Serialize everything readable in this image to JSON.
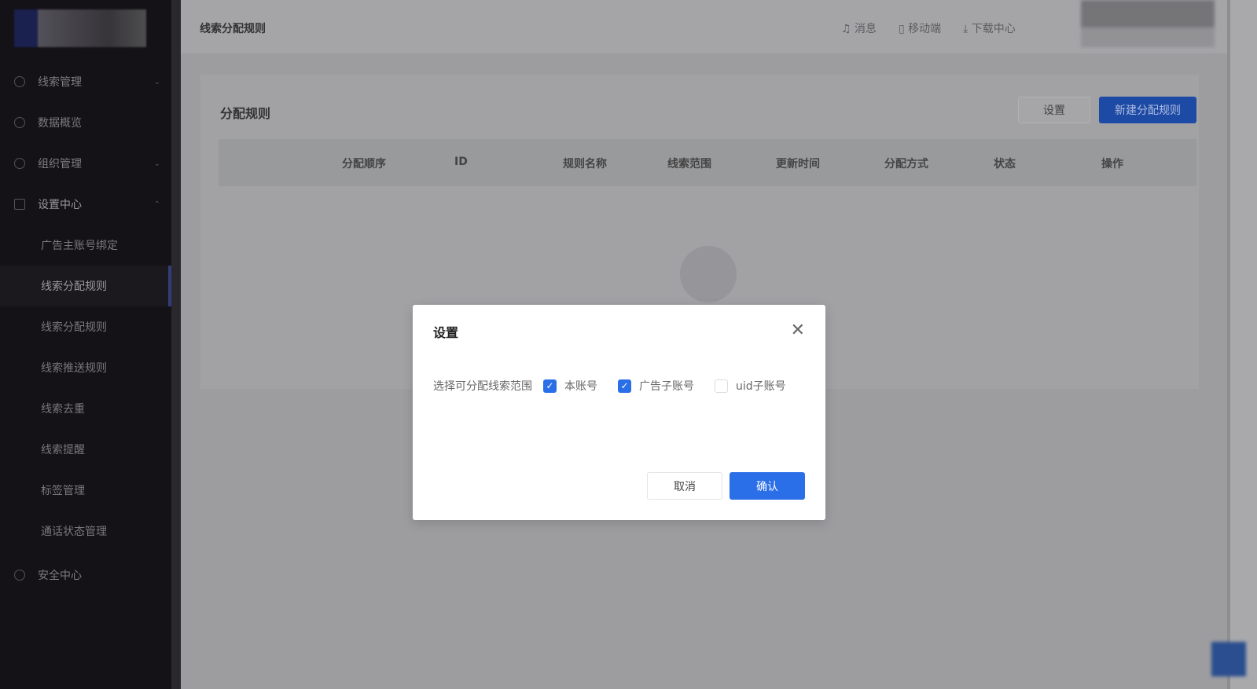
{
  "sidebar": {
    "items": [
      {
        "label": "线索管理"
      },
      {
        "label": "数据概览"
      },
      {
        "label": "组织管理"
      },
      {
        "label": "设置中心"
      }
    ],
    "sub_items": [
      {
        "label": "广告主账号绑定"
      },
      {
        "label": "线索分配规则"
      },
      {
        "label": "线索分配规则"
      },
      {
        "label": "线索推送规则"
      },
      {
        "label": "线索去重"
      },
      {
        "label": "线索提醒"
      },
      {
        "label": "标签管理"
      },
      {
        "label": "通话状态管理"
      }
    ],
    "bottom": {
      "label": "安全中心"
    }
  },
  "header": {
    "title": "线索分配规则",
    "links": [
      {
        "label": "消息"
      },
      {
        "label": "移动端"
      },
      {
        "label": "下载中心"
      }
    ]
  },
  "card": {
    "title": "分配规则",
    "settings_label": "设置",
    "new_label": "新建分配规则",
    "columns": [
      "分配顺序",
      "ID",
      "规则名称",
      "线索范围",
      "更新时间",
      "分配方式",
      "状态",
      "操作"
    ]
  },
  "modal": {
    "title": "设置",
    "field_label": "选择可分配线索范围",
    "options": [
      {
        "label": "本账号",
        "checked": true
      },
      {
        "label": "广告子账号",
        "checked": true
      },
      {
        "label": "uid子账号",
        "checked": false
      }
    ],
    "cancel": "取消",
    "confirm": "确认"
  },
  "colors": {
    "primary": "#2a6ee8",
    "sidebar": "#141117"
  }
}
